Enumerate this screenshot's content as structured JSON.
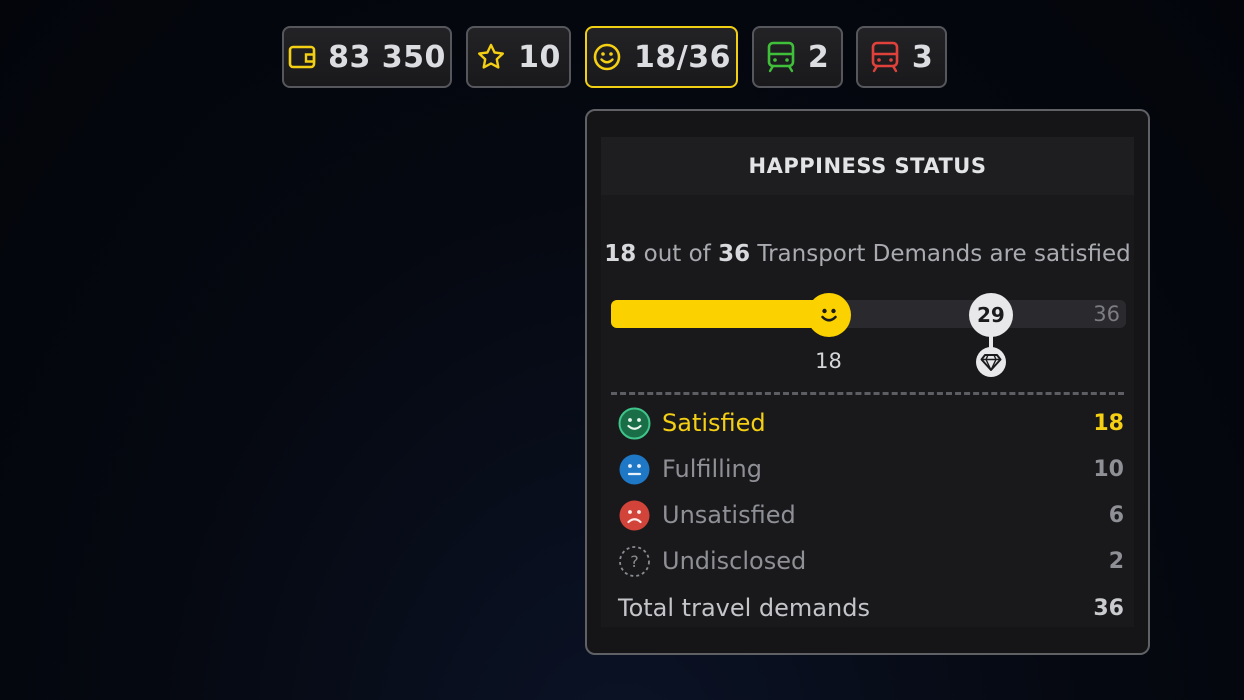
{
  "topbar": {
    "money": {
      "icon": "wallet-icon",
      "value": "83 350"
    },
    "stars": {
      "icon": "star-icon",
      "value": "10"
    },
    "happiness": {
      "icon": "smiley-icon",
      "value": "18/36"
    },
    "trains_green": {
      "icon": "train-icon",
      "value": "2"
    },
    "trains_red": {
      "icon": "train-icon",
      "value": "3"
    }
  },
  "panel": {
    "title": "HAPPINESS STATUS",
    "summary": {
      "current": "18",
      "mid1": " out of ",
      "total": "36",
      "mid2": " Transport Demands are satisfied"
    },
    "progress": {
      "current": 18,
      "goal": 29,
      "max": 36,
      "current_label": "18",
      "goal_label": "29",
      "max_label": "36"
    },
    "rows": [
      {
        "label": "Satisfied",
        "value": "18",
        "icon": "happy-face-icon",
        "color": "#2fa36b"
      },
      {
        "label": "Fulfilling",
        "value": "10",
        "icon": "neutral-face-icon",
        "color": "#1e7ecf"
      },
      {
        "label": "Unsatisfied",
        "value": "6",
        "icon": "sad-face-icon",
        "color": "#d6453a"
      },
      {
        "label": "Undisclosed",
        "value": "2",
        "icon": "question-icon",
        "color": "#8a8c91"
      }
    ],
    "total": {
      "label": "Total travel demands",
      "value": "36"
    }
  },
  "colors": {
    "accent": "#fbd200",
    "green": "#2fa36b",
    "blue": "#1e7ecf",
    "red": "#d6453a"
  }
}
